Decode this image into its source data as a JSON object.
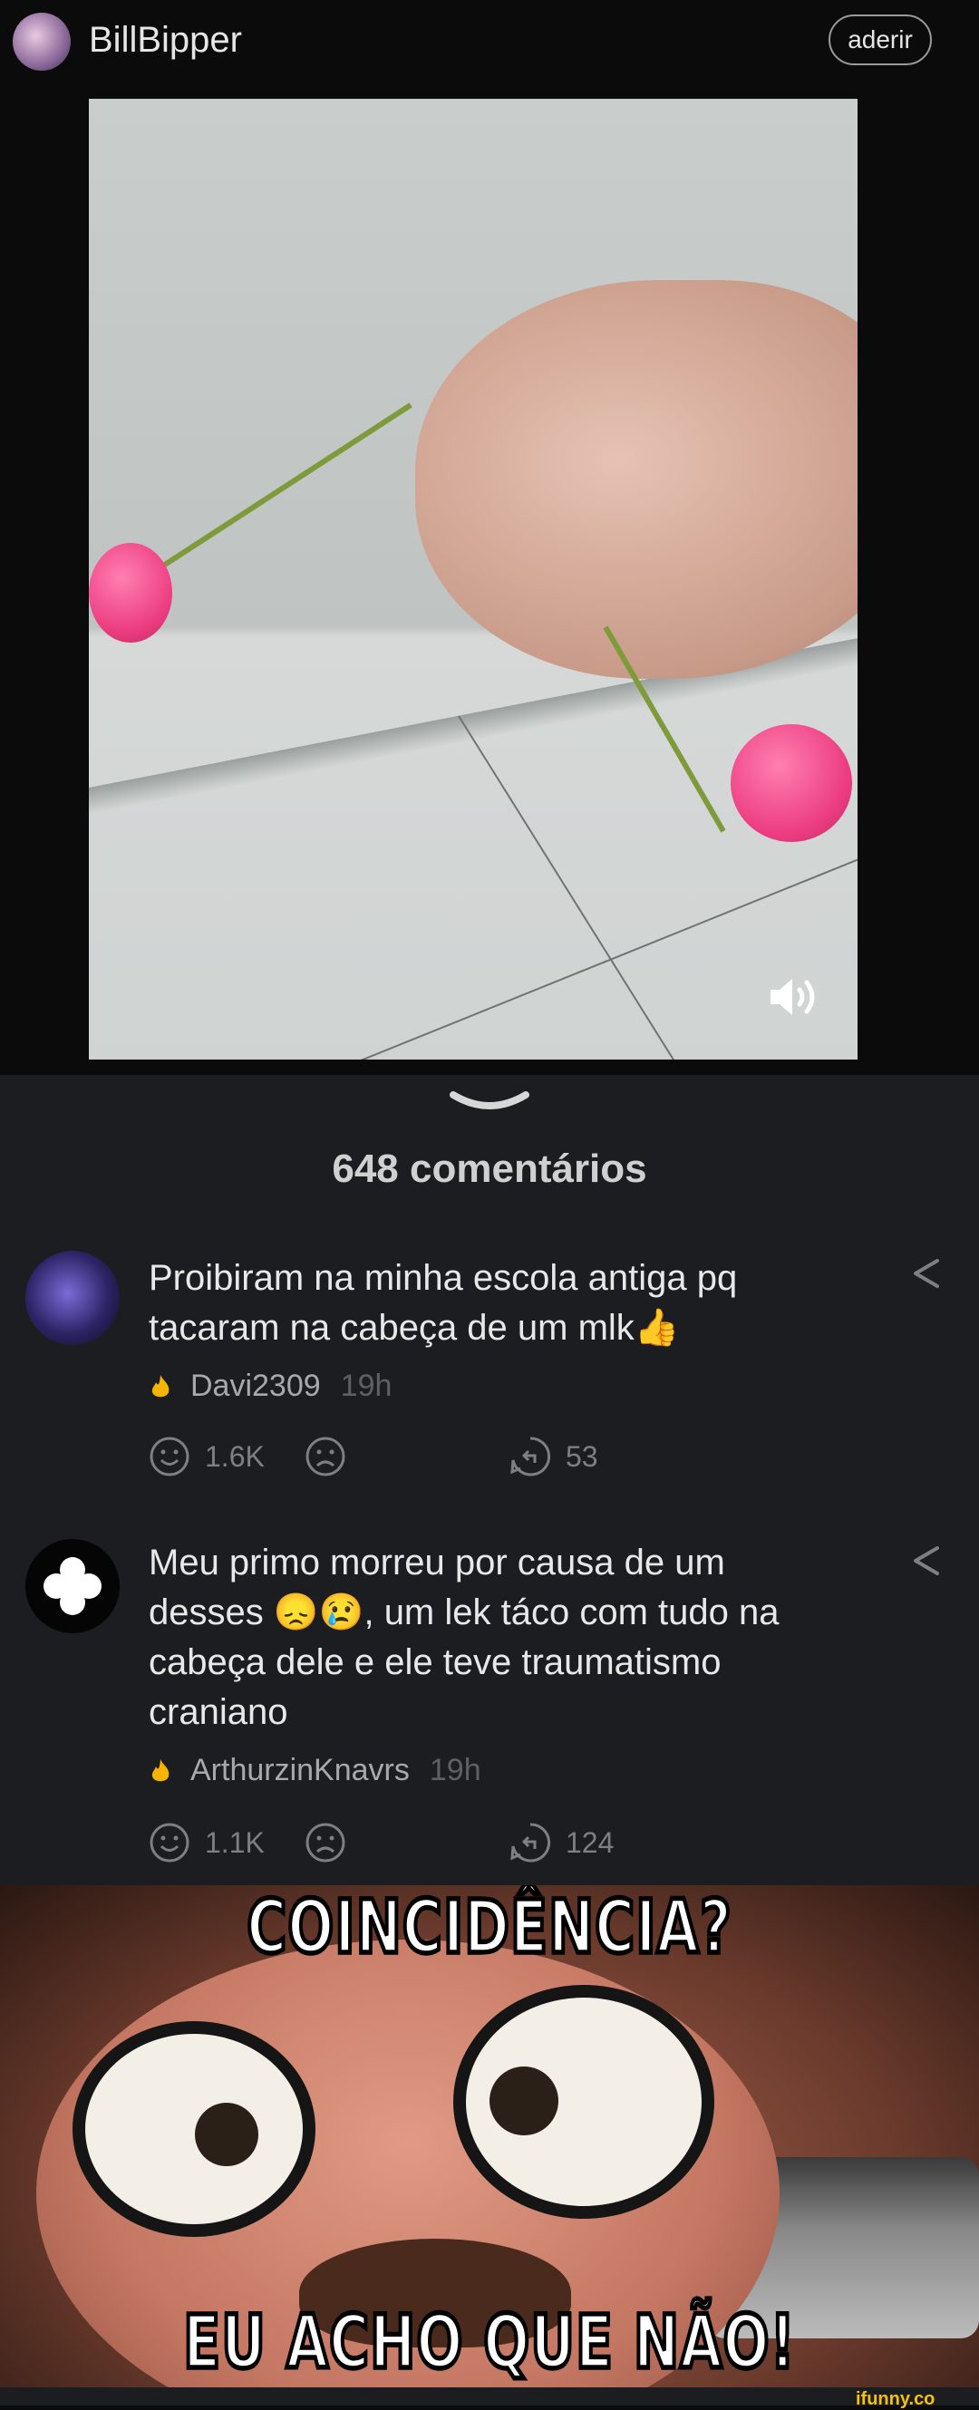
{
  "header": {
    "username": "BillBipper",
    "join_label": "aderir"
  },
  "comments_section": {
    "count_label": "648 comentários",
    "items": [
      {
        "text": "Proibiram na minha escola antiga pq tacaram na cabeça de um mlk👍",
        "author": "Davi2309",
        "time": "19h",
        "smiles": "1.6K",
        "replies": "53"
      },
      {
        "text": "Meu primo morreu por causa de um desses 😞😢, um lek táco com tudo na cabeça dele e ele teve traumatismo craniano",
        "author": "ArthurzinKnavrs",
        "time": "19h",
        "smiles": "1.1K",
        "replies": "124"
      }
    ]
  },
  "meme": {
    "top_text": "COINCIDÊNCIA?",
    "bottom_text": "EU ACHO QUE NÃO!"
  },
  "watermark": "ifunny.co",
  "colors": {
    "background": "#0b0b0b",
    "comments_bg": "#1c1d21",
    "flame": "#f4b400",
    "watermark": "#f4c20d"
  }
}
